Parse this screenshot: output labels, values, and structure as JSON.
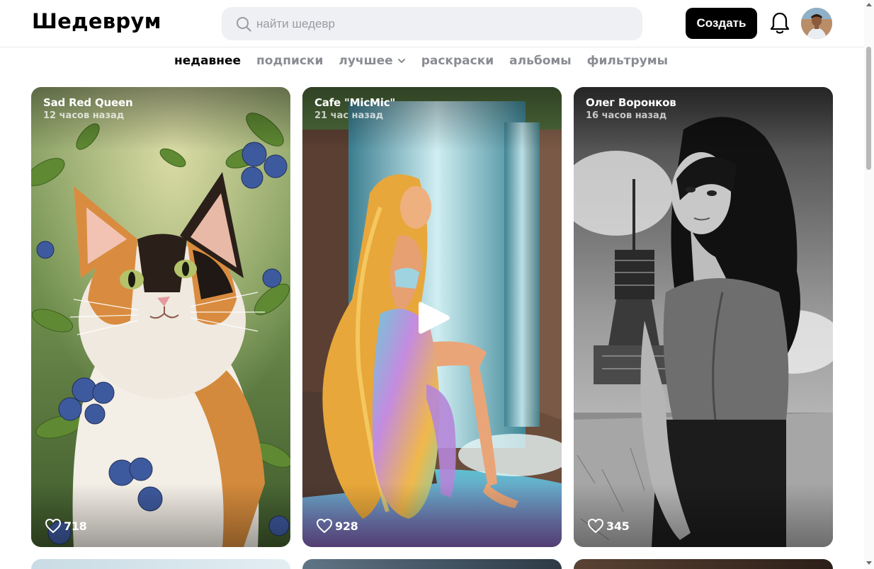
{
  "app": {
    "logo": "Шедеврум"
  },
  "header": {
    "search_placeholder": "найти шедевр",
    "search_value": "",
    "create_label": "Создать",
    "icons": {
      "search": "search-icon",
      "notifications": "bell-icon",
      "avatar": "user-avatar"
    }
  },
  "tabs": [
    {
      "label": "недавнее",
      "active": true
    },
    {
      "label": "подписки",
      "active": false
    },
    {
      "label": "лучшее",
      "active": false,
      "has_dropdown": true
    },
    {
      "label": "раскраски",
      "active": false
    },
    {
      "label": "альбомы",
      "active": false
    },
    {
      "label": "фильтрумы",
      "active": false
    }
  ],
  "cards": [
    {
      "title": "Sad Red Queen",
      "time": "12 часов назад",
      "likes": "718",
      "image": "calico cat among blueberry bushes",
      "video": false
    },
    {
      "title": "Cafe \"MicMic\"",
      "time": "21 час назад",
      "likes": "928",
      "image": "golden-haired woman sitting by waterfall",
      "video": true
    },
    {
      "title": "Олег Воронков",
      "time": "16 часов назад",
      "likes": "345",
      "image": "black-and-white woman in front of tower",
      "video": false
    }
  ],
  "colors": {
    "accent": "#000000",
    "tab_inactive": "#8a8c93",
    "search_bg": "#eff0f3"
  }
}
